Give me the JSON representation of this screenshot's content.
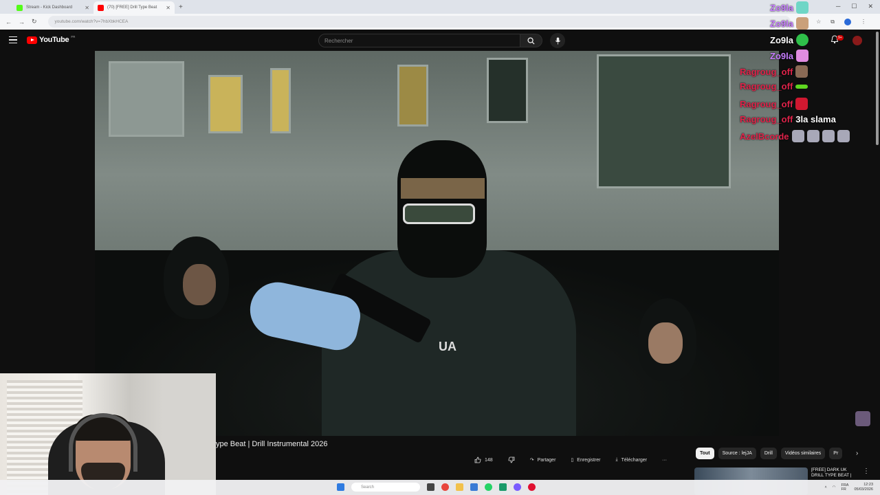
{
  "browser": {
    "tabs": [
      {
        "title": "Stream - Kick Dashboard",
        "fav_color": "#53fc18",
        "active": false
      },
      {
        "title": "(70) [FREE] Drill Type Beat",
        "fav_color": "#ff0000",
        "active": true
      }
    ],
    "new_tab": "+",
    "url": "youtube.com/watch?v=7hbXbkHCEA",
    "win_min": "─",
    "win_max": "☐",
    "win_close": "✕"
  },
  "youtube": {
    "logo_text": "YouTube",
    "logo_country": "FR",
    "search_placeholder": "Rechercher",
    "bell_count": "9+",
    "video_title": "ype Beat | Drill Instrumental 2026",
    "like_count": "148",
    "actions": {
      "share": "Partager",
      "save": "Enregistrer",
      "download": "Télécharger",
      "more": "···"
    },
    "chips": [
      "Tout",
      "Source : lejJA",
      "Drill",
      "Vidéos similaires",
      "Pr"
    ],
    "rec_title": "[FREE] DARK UK DRILL TYPE BEAT |",
    "video_logo": "UA"
  },
  "chat": [
    {
      "user": "Zo9la",
      "color": "#c77dff",
      "msg": "",
      "emote": "#6fd6c6"
    },
    {
      "user": "Zo9la",
      "color": "#c77dff",
      "msg": "",
      "emote": "#caa07a"
    },
    {
      "user": "Zo9la",
      "color": "#ffffff",
      "msg": "",
      "emote": "#2fc04a"
    },
    {
      "user": "Zo9la",
      "color": "#c77dff",
      "msg": "",
      "emote": "#e08ce0"
    },
    {
      "user": "Ragroug_off",
      "color": "#e0234a",
      "msg": "",
      "emote": "#8a6a55"
    },
    {
      "user": "Ragroug_off",
      "color": "#e0234a",
      "msg": "",
      "emote": "#5fd620"
    },
    {
      "user": "Ragroug_off",
      "color": "#e0234a",
      "msg": "",
      "emote": "#d01830"
    },
    {
      "user": "Ragroug_off",
      "color": "#e0234a",
      "msg": "3la slama",
      "emote": ""
    },
    {
      "user": "AzelBcorde",
      "color": "#e0234a",
      "msg": "",
      "emote": "#a8a8b8"
    }
  ],
  "taskbar": {
    "search": "Search",
    "lang": "FRA\nFR",
    "time": "12:23",
    "date": "05/03/2026"
  }
}
